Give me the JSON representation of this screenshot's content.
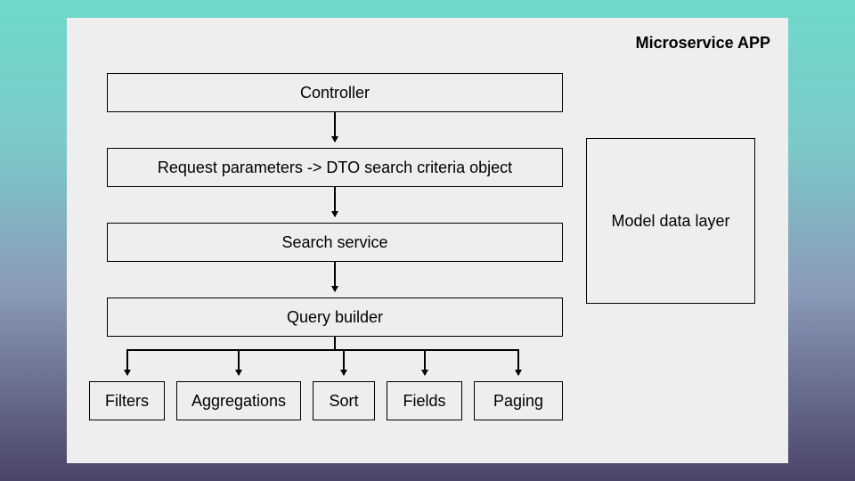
{
  "title": "Microservice APP",
  "boxes": {
    "controller": "Controller",
    "request_dto": "Request parameters -> DTO search criteria object",
    "search_service": "Search service",
    "query_builder": "Query builder",
    "filters": "Filters",
    "aggregations": "Aggregations",
    "sort": "Sort",
    "fields": "Fields",
    "paging": "Paging",
    "model_data_layer": "Model data layer"
  }
}
